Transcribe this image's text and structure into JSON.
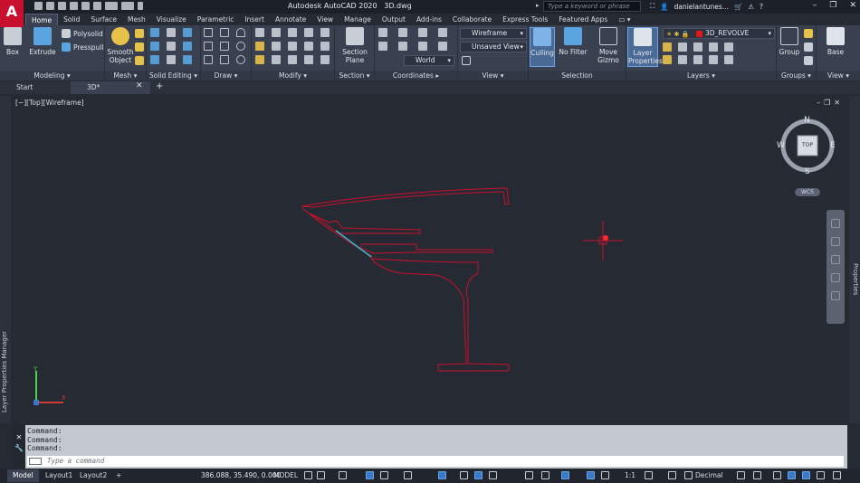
{
  "titlebar": {
    "app_logo": "A",
    "app_title": "Autodesk AutoCAD 2020",
    "file_name": "3D.dwg",
    "search_placeholder": "Type a keyword or phrase",
    "user": "danielantunes...",
    "icons": [
      "new-icon",
      "open-icon",
      "save-icon",
      "saveas-icon",
      "plot-icon",
      "undo-icon",
      "redo-icon",
      "cart-icon",
      "help-icon"
    ]
  },
  "ribbon_tabs": [
    "Home",
    "Solid",
    "Surface",
    "Mesh",
    "Visualize",
    "Parametric",
    "Insert",
    "Annotate",
    "View",
    "Manage",
    "Output",
    "Add-ins",
    "Collaborate",
    "Express Tools",
    "Featured Apps"
  ],
  "ribbon": {
    "modeling": {
      "title": "Modeling",
      "box": "Box",
      "extrude": "Extrude",
      "polysolid": "Polysolid",
      "presspull": "Presspull"
    },
    "mesh": {
      "title": "Mesh",
      "smooth_object": "Smooth Object"
    },
    "solid_editing": {
      "title": "Solid Editing"
    },
    "draw": {
      "title": "Draw"
    },
    "modify": {
      "title": "Modify"
    },
    "section": {
      "title": "Section",
      "section_plane": "Section Plane"
    },
    "coordinates": {
      "title": "Coordinates",
      "world": "World"
    },
    "view": {
      "title": "View",
      "visual_style": "Wireframe",
      "named_view": "Unsaved View"
    },
    "selection": {
      "title": "Selection",
      "culling": "Culling",
      "no_filter": "No Filter",
      "move_gizmo": "Move Gizmo"
    },
    "layers": {
      "title": "Layers",
      "layer_properties": "Layer Properties",
      "current_layer": "3D_REVOLVE",
      "layer_color": "#e01818"
    },
    "groups": {
      "title": "Groups",
      "group": "Group"
    },
    "viewpanel": {
      "title": "View",
      "base": "Base"
    }
  },
  "doc_tabs": {
    "start": "Start",
    "active": "3D*"
  },
  "viewport": {
    "label": "[−][Top][Wireframe]",
    "viewcube": {
      "north": "N",
      "south": "S",
      "east": "E",
      "west": "W",
      "face": "TOP",
      "ucs": "WCS"
    },
    "left_palette": "Layer Properties Manager",
    "right_palette": "Properties",
    "geometry_color": "#c8102e",
    "highlight_color": "#3fb6c9"
  },
  "command": {
    "history": [
      "Command:",
      "Command:",
      "Command:"
    ],
    "placeholder": "Type a command"
  },
  "statusbar": {
    "tabs": [
      "Model",
      "Layout1",
      "Layout2"
    ],
    "coordinates": "386.088, 35.490, 0.000",
    "space": "MODEL",
    "scale": "1:1",
    "units": "Decimal"
  }
}
